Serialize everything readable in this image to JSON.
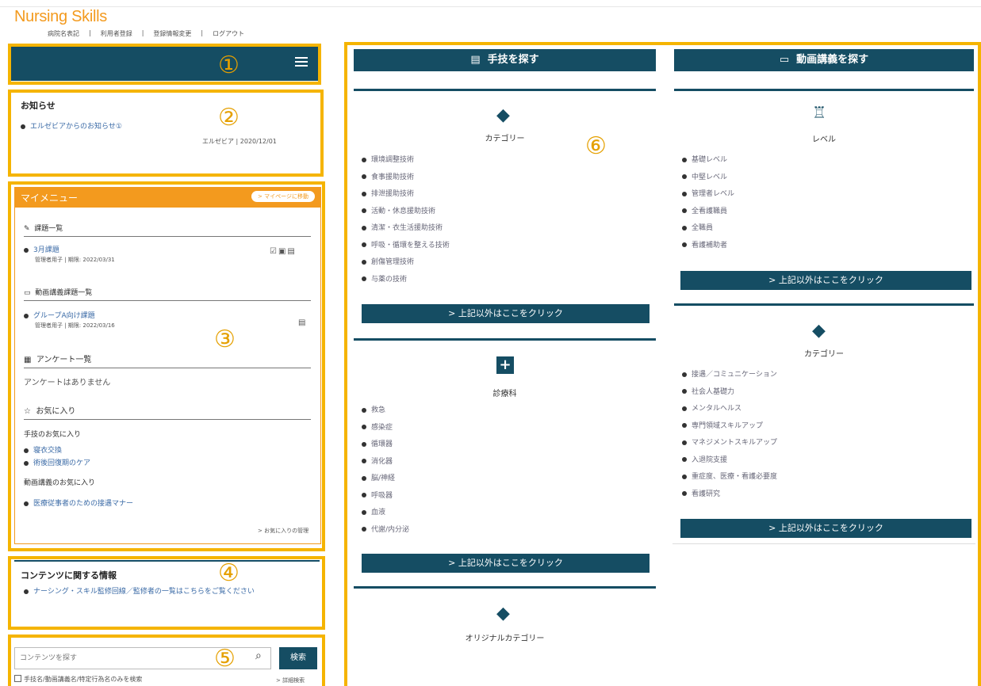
{
  "header": {
    "logo": "Nursing Skills",
    "links": [
      "病院名表記",
      "利用者登録",
      "登録情報変更",
      "ログアウト"
    ]
  },
  "markers": [
    "①",
    "②",
    "③",
    "④",
    "⑤",
    "⑥"
  ],
  "notice": {
    "title": "お知らせ",
    "item": "エルゼビアからのお知らせ①",
    "meta": "エルゼビア | 2020/12/01"
  },
  "mymenu": {
    "title": "マイメニュー",
    "mypage_btn": "> マイページに移動",
    "tasks_title": "課題一覧",
    "task_name": "3月課題",
    "task_meta": "管理者用子 | 期限: 2022/03/31",
    "video_tasks_title": "動画講義課題一覧",
    "video_task_name": "グループA向け課題",
    "video_task_meta": "管理者用子 | 期限: 2022/03/16",
    "survey_title": "アンケート一覧",
    "survey_empty": "アンケートはありません",
    "fav_title": "お気に入り",
    "fav_skill_title": "手技のお気に入り",
    "fav_skill_items": [
      "寝衣交換",
      "術後回復期のケア"
    ],
    "fav_video_title": "動画講義のお気に入り",
    "fav_video_items": [
      "医療従事者のための接遇マナー"
    ],
    "fav_manage": "> お気に入りの管理"
  },
  "content_info": {
    "title": "コンテンツに関する情報",
    "item": "ナーシング・スキル監修回線／監修者の一覧はこちらをご覧ください"
  },
  "search": {
    "placeholder": "コンテンツを探す",
    "button": "検索",
    "checkbox_label": "手技名/動画講義名/特定行為名のみを検索",
    "advanced": "> 詳細検索"
  },
  "skills": {
    "header": "手技を探す",
    "category_title": "カテゴリー",
    "category_items": [
      "環境調整技術",
      "食事援助技術",
      "排泄援助技術",
      "活動・休息援助技術",
      "清潔・衣生活援助技術",
      "呼吸・循環を整える技術",
      "創傷管理技術",
      "与薬の技術"
    ],
    "more1": "> 上記以外はここをクリック",
    "dept_title": "診療科",
    "dept_items": [
      "救急",
      "感染症",
      "循環器",
      "消化器",
      "脳/神経",
      "呼吸器",
      "血液",
      "代謝/内分泌"
    ],
    "more2": "> 上記以外はここをクリック",
    "original_title": "オリジナルカテゴリー"
  },
  "videos": {
    "header": "動画講義を探す",
    "level_title": "レベル",
    "level_items": [
      "基礎レベル",
      "中堅レベル",
      "管理者レベル",
      "全看護職員",
      "全職員",
      "看護補助者"
    ],
    "more1": "> 上記以外はここをクリック",
    "category_title": "カテゴリー",
    "category_items": [
      "接遇／コミュニケーション",
      "社会人基礎力",
      "メンタルヘルス",
      "専門領域スキルアップ",
      "マネジメントスキルアップ",
      "入退院支援",
      "重症度、医療・看護必要度",
      "看護研究"
    ],
    "more2": "> 上記以外はここをクリック"
  }
}
